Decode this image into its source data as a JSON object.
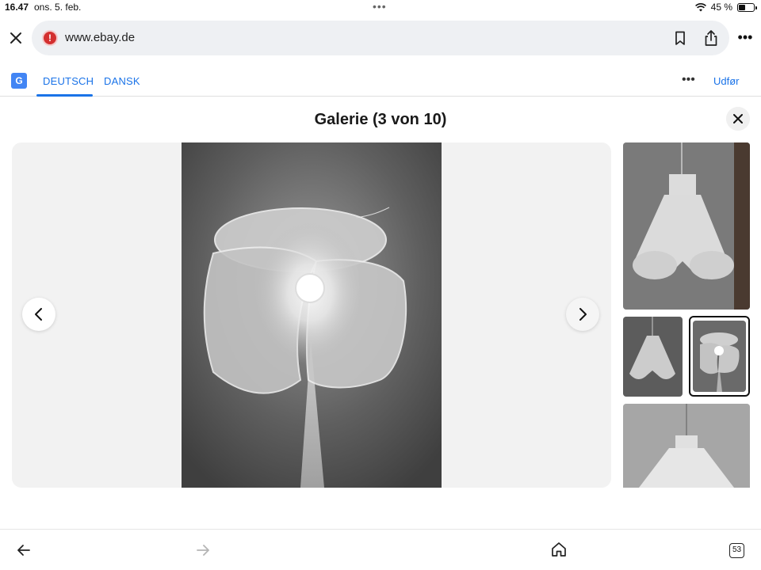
{
  "status_bar": {
    "time": "16.47",
    "date": "ons. 5. feb.",
    "battery": "45 %",
    "battery_level": 0.45
  },
  "address_bar": {
    "url": "www.ebay.de",
    "security_warning_symbol": "!"
  },
  "translate_bar": {
    "google_translate_glyph": "G",
    "languages": [
      {
        "label": "DEUTSCH",
        "active": true
      },
      {
        "label": "DANSK",
        "active": false
      }
    ],
    "more_symbol": "•••",
    "action_label": "Udfør"
  },
  "gallery": {
    "title": "Galerie (3 von 10)",
    "thumbnails_count_visible": 4,
    "selected_thumbnail": 3
  },
  "bottom_bar": {
    "tab_count": "53"
  },
  "colors": {
    "link_blue": "#1a73e8",
    "warning_red": "#d32f2f",
    "stage_bg": "#f2f2f2",
    "url_pill_bg": "#eef0f3"
  },
  "icons": [
    "close-icon",
    "warning-icon",
    "bookmark-icon",
    "share-icon",
    "more-icon",
    "google-translate-icon",
    "chevron-left-icon",
    "chevron-right-icon",
    "back-arrow-icon",
    "forward-arrow-icon",
    "home-icon",
    "tabs-icon",
    "wifi-icon",
    "battery-icon"
  ]
}
